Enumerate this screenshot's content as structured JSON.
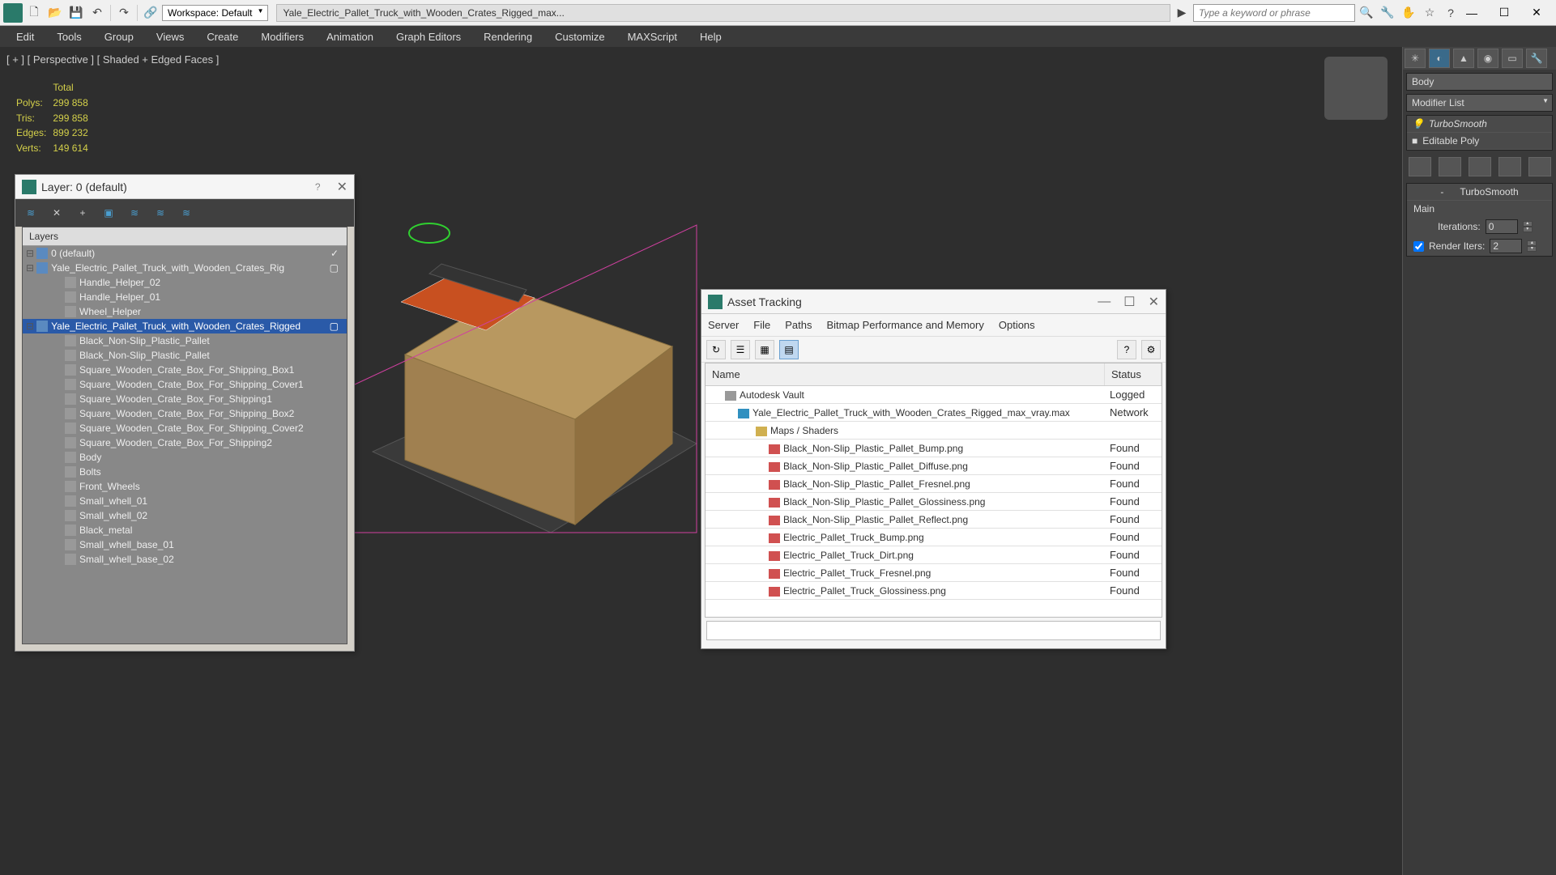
{
  "app": {
    "workspace_label": "Workspace: Default",
    "title": "Yale_Electric_Pallet_Truck_with_Wooden_Crates_Rigged_max...",
    "search_placeholder": "Type a keyword or phrase"
  },
  "menu": [
    "Edit",
    "Tools",
    "Group",
    "Views",
    "Create",
    "Modifiers",
    "Animation",
    "Graph Editors",
    "Rendering",
    "Customize",
    "MAXScript",
    "Help"
  ],
  "viewport": {
    "label": "[ + ] [ Perspective ] [ Shaded + Edged Faces ]",
    "stats_header": "Total",
    "stats": [
      {
        "k": "Polys:",
        "v": "299 858"
      },
      {
        "k": "Tris:",
        "v": "299 858"
      },
      {
        "k": "Edges:",
        "v": "899 232"
      },
      {
        "k": "Verts:",
        "v": "149 614"
      }
    ]
  },
  "right_panel": {
    "object_name": "Body",
    "modifier_list_label": "Modifier List",
    "stack": [
      "TurboSmooth",
      "Editable Poly"
    ],
    "rollout_title": "TurboSmooth",
    "main_label": "Main",
    "iterations_label": "Iterations:",
    "iterations_value": "0",
    "render_iters_label": "Render Iters:",
    "render_iters_value": "2"
  },
  "layer_dialog": {
    "title": "Layer: 0 (default)",
    "header": "Layers",
    "rows": [
      {
        "text": "0 (default)",
        "indent": 0,
        "type": "layer",
        "check": true
      },
      {
        "text": "Yale_Electric_Pallet_Truck_with_Wooden_Crates_Rig",
        "indent": 0,
        "type": "layer"
      },
      {
        "text": "Handle_Helper_02",
        "indent": 2,
        "type": "obj"
      },
      {
        "text": "Handle_Helper_01",
        "indent": 2,
        "type": "obj"
      },
      {
        "text": "Wheel_Helper",
        "indent": 2,
        "type": "obj"
      },
      {
        "text": "Yale_Electric_Pallet_Truck_with_Wooden_Crates_Rigged",
        "indent": 0,
        "type": "layer",
        "selected": true
      },
      {
        "text": "Black_Non-Slip_Plastic_Pallet",
        "indent": 2,
        "type": "obj"
      },
      {
        "text": "Black_Non-Slip_Plastic_Pallet",
        "indent": 2,
        "type": "obj"
      },
      {
        "text": "Square_Wooden_Crate_Box_For_Shipping_Box1",
        "indent": 2,
        "type": "obj"
      },
      {
        "text": "Square_Wooden_Crate_Box_For_Shipping_Cover1",
        "indent": 2,
        "type": "obj"
      },
      {
        "text": "Square_Wooden_Crate_Box_For_Shipping1",
        "indent": 2,
        "type": "obj"
      },
      {
        "text": "Square_Wooden_Crate_Box_For_Shipping_Box2",
        "indent": 2,
        "type": "obj"
      },
      {
        "text": "Square_Wooden_Crate_Box_For_Shipping_Cover2",
        "indent": 2,
        "type": "obj"
      },
      {
        "text": "Square_Wooden_Crate_Box_For_Shipping2",
        "indent": 2,
        "type": "obj"
      },
      {
        "text": "Body",
        "indent": 2,
        "type": "obj"
      },
      {
        "text": "Bolts",
        "indent": 2,
        "type": "obj"
      },
      {
        "text": "Front_Wheels",
        "indent": 2,
        "type": "obj"
      },
      {
        "text": "Small_whell_01",
        "indent": 2,
        "type": "obj"
      },
      {
        "text": "Small_whell_02",
        "indent": 2,
        "type": "obj"
      },
      {
        "text": "Black_metal",
        "indent": 2,
        "type": "obj"
      },
      {
        "text": "Small_whell_base_01",
        "indent": 2,
        "type": "obj"
      },
      {
        "text": "Small_whell_base_02",
        "indent": 2,
        "type": "obj"
      }
    ]
  },
  "asset_dialog": {
    "title": "Asset Tracking",
    "menu": [
      "Server",
      "File",
      "Paths",
      "Bitmap Performance and Memory",
      "Options"
    ],
    "col_name": "Name",
    "col_status": "Status",
    "rows": [
      {
        "name": "Autodesk Vault",
        "status": "Logged",
        "indent": 24,
        "icon": "vault"
      },
      {
        "name": "Yale_Electric_Pallet_Truck_with_Wooden_Crates_Rigged_max_vray.max",
        "status": "Network",
        "indent": 40,
        "icon": "max"
      },
      {
        "name": "Maps / Shaders",
        "status": "",
        "indent": 62,
        "icon": "folder"
      },
      {
        "name": "Black_Non-Slip_Plastic_Pallet_Bump.png",
        "status": "Found",
        "indent": 78,
        "icon": "png"
      },
      {
        "name": "Black_Non-Slip_Plastic_Pallet_Diffuse.png",
        "status": "Found",
        "indent": 78,
        "icon": "png"
      },
      {
        "name": "Black_Non-Slip_Plastic_Pallet_Fresnel.png",
        "status": "Found",
        "indent": 78,
        "icon": "png"
      },
      {
        "name": "Black_Non-Slip_Plastic_Pallet_Glossiness.png",
        "status": "Found",
        "indent": 78,
        "icon": "png"
      },
      {
        "name": "Black_Non-Slip_Plastic_Pallet_Reflect.png",
        "status": "Found",
        "indent": 78,
        "icon": "png"
      },
      {
        "name": "Electric_Pallet_Truck_Bump.png",
        "status": "Found",
        "indent": 78,
        "icon": "png"
      },
      {
        "name": "Electric_Pallet_Truck_Dirt.png",
        "status": "Found",
        "indent": 78,
        "icon": "png"
      },
      {
        "name": "Electric_Pallet_Truck_Fresnel.png",
        "status": "Found",
        "indent": 78,
        "icon": "png"
      },
      {
        "name": "Electric_Pallet_Truck_Glossiness.png",
        "status": "Found",
        "indent": 78,
        "icon": "png"
      }
    ]
  }
}
